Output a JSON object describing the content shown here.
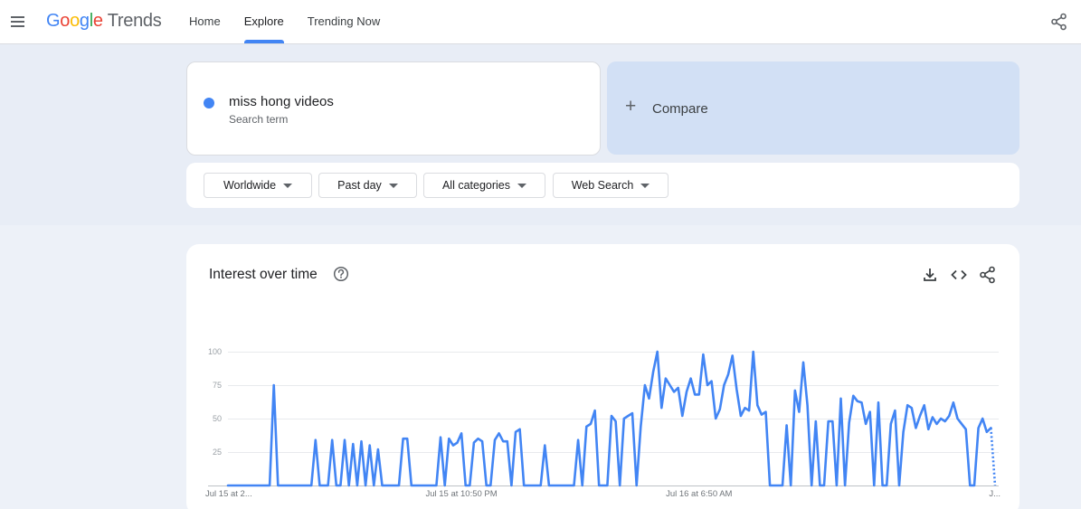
{
  "header": {
    "logo": {
      "google": [
        "G",
        "o",
        "o",
        "g",
        "l",
        "e"
      ],
      "product": "Trends"
    },
    "tabs": [
      {
        "label": "Home",
        "active": false
      },
      {
        "label": "Explore",
        "active": true
      },
      {
        "label": "Trending Now",
        "active": false
      }
    ],
    "icons": {
      "menu": "hamburger-menu-icon",
      "share": "share-icon"
    }
  },
  "search": {
    "term": "miss hong videos",
    "term_type": "Search term",
    "term_color": "#4285f4",
    "compare_plus": "+",
    "compare_label": "Compare"
  },
  "filters": [
    {
      "label": "Worldwide"
    },
    {
      "label": "Past day"
    },
    {
      "label": "All categories"
    },
    {
      "label": "Web Search"
    }
  ],
  "chart_section": {
    "title": "Interest over time",
    "icons": [
      "help-icon",
      "download-icon",
      "embed-code-icon",
      "share-icon"
    ]
  },
  "chart_data": {
    "type": "line",
    "ylim": [
      0,
      100
    ],
    "yticks": [
      25,
      50,
      75,
      100
    ],
    "grid": true,
    "xtick_labels": [
      "Jul 15 at 2...",
      "Jul 15 at 10:50 PM",
      "Jul 16 at 6:50 AM",
      "J..."
    ],
    "xtick_index": [
      2,
      56,
      113,
      180
    ],
    "series": [
      {
        "color": "#4285f4",
        "partial_last_point": true,
        "values": [
          0,
          0,
          0,
          0,
          0,
          0,
          0,
          0,
          0,
          0,
          0,
          75,
          0,
          0,
          0,
          0,
          0,
          0,
          0,
          0,
          0,
          34,
          0,
          0,
          0,
          34,
          0,
          0,
          34,
          0,
          31,
          0,
          33,
          0,
          30,
          0,
          27,
          0,
          0,
          0,
          0,
          0,
          35,
          35,
          0,
          0,
          0,
          0,
          0,
          0,
          0,
          36,
          0,
          35,
          30,
          32,
          39,
          0,
          0,
          32,
          35,
          33,
          0,
          0,
          34,
          39,
          33,
          33,
          0,
          40,
          42,
          0,
          0,
          0,
          0,
          0,
          30,
          0,
          0,
          0,
          0,
          0,
          0,
          0,
          34,
          0,
          44,
          46,
          56,
          0,
          0,
          0,
          52,
          48,
          0,
          50,
          52,
          54,
          0,
          44,
          75,
          65,
          85,
          100,
          58,
          80,
          75,
          70,
          73,
          52,
          70,
          80,
          68,
          68,
          98,
          75,
          78,
          50,
          57,
          75,
          83,
          97,
          72,
          52,
          58,
          56,
          100,
          60,
          53,
          55,
          0,
          0,
          0,
          0,
          45,
          0,
          71,
          55,
          92,
          60,
          0,
          48,
          0,
          0,
          48,
          48,
          0,
          65,
          0,
          47,
          67,
          63,
          62,
          46,
          55,
          0,
          62,
          0,
          0,
          46,
          56,
          0,
          40,
          60,
          58,
          43,
          52,
          60,
          42,
          51,
          46,
          50,
          48,
          52,
          62,
          50,
          46,
          42,
          0,
          0,
          43,
          50,
          40,
          43,
          0
        ]
      }
    ]
  }
}
